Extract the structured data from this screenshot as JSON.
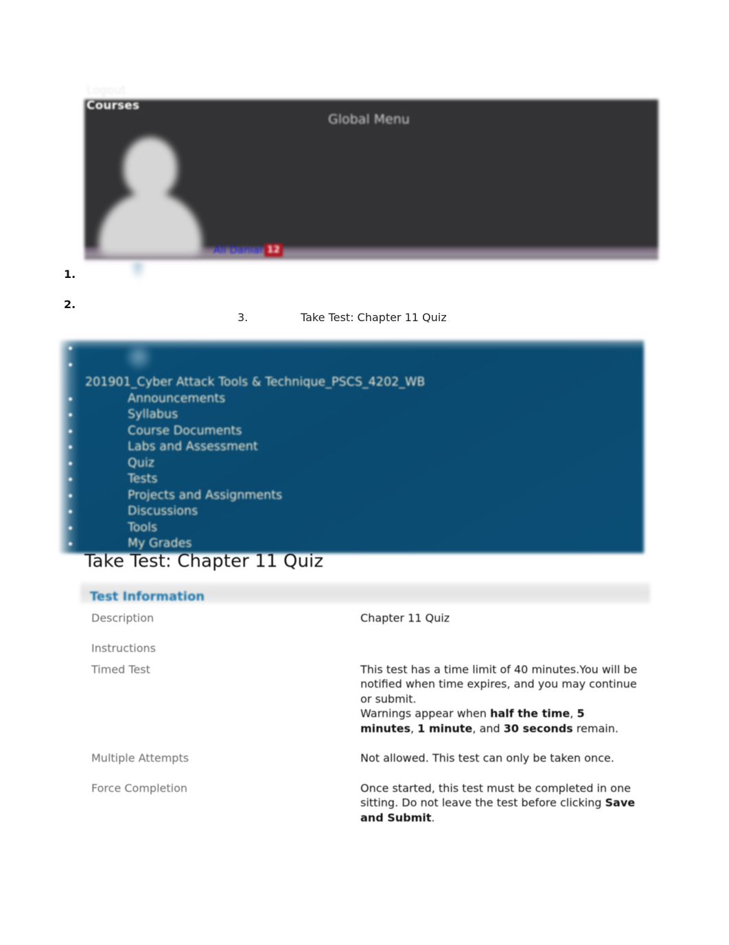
{
  "header": {
    "logout_label": "Logout",
    "courses_label": "Courses",
    "global_menu_label": "Global Menu",
    "user_name": "Ali Danial",
    "user_badge_count": "12",
    "avatar_icon": "user-avatar-icon",
    "background_color": "#333335"
  },
  "breadcrumb_list": {
    "item1_marker": "1.",
    "item2_marker": "2.",
    "item3_marker": "3.",
    "item3_label": "Take Test: Chapter 11 Quiz"
  },
  "course_nav": {
    "background_color": "#0a4a70",
    "text_color": "#f3e9cf",
    "course_title": "201901_Cyber Attack Tools & Technique_PSCS_4202_WB",
    "items": [
      {
        "label": ""
      },
      {
        "label": ""
      },
      {
        "label": "Announcements"
      },
      {
        "label": "Syllabus"
      },
      {
        "label": "Course Documents"
      },
      {
        "label": "Labs and Assessment"
      },
      {
        "label": "Quiz"
      },
      {
        "label": "Tests"
      },
      {
        "label": "Projects and Assignments"
      },
      {
        "label": "Discussions"
      },
      {
        "label": "Tools"
      },
      {
        "label": "My Grades"
      }
    ]
  },
  "page": {
    "title": "Take Test: Chapter 11 Quiz"
  },
  "test_information": {
    "section_title": "Test Information",
    "section_title_color": "#2077ac",
    "rows": [
      {
        "label": "Description",
        "value": "Chapter 11 Quiz"
      },
      {
        "label": "Instructions",
        "value": ""
      },
      {
        "label": "Timed Test",
        "value_line1": "This test has a time limit of 40 minutes.You will be notified when time expires, and you may continue or submit.",
        "value_line2_pre": "Warnings appear when ",
        "value_bold1": "half the time",
        "value_sep1": ", ",
        "value_bold2": "5 minutes",
        "value_sep2": ", ",
        "value_bold3": "1 minute",
        "value_sep3": ", and ",
        "value_bold4": "30 seconds",
        "value_tail": " remain."
      },
      {
        "label": "Multiple Attempts",
        "value": "Not allowed. This test can only be taken once."
      },
      {
        "label": "Force Completion",
        "value_pre": "Once started, this test must be completed in one sitting. Do not leave the test before clicking ",
        "value_bold": "Save and Submit",
        "value_tail": "."
      }
    ]
  }
}
